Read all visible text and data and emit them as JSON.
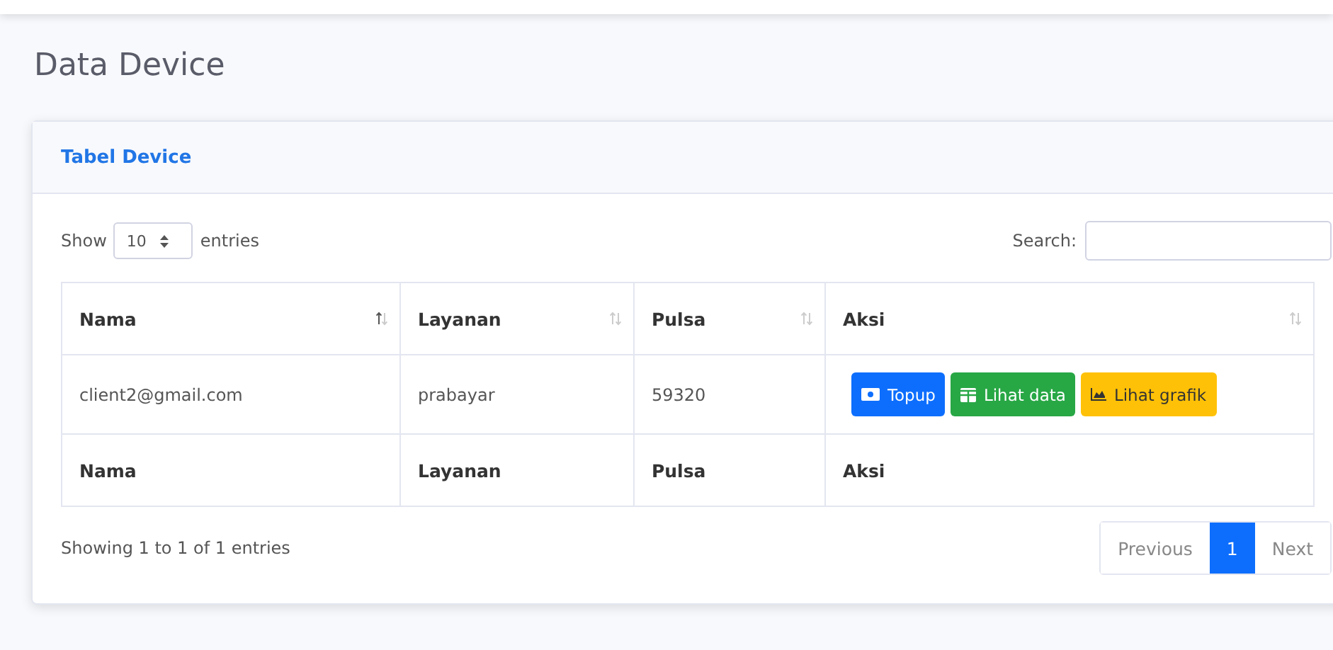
{
  "page_title": "Data Device",
  "card": {
    "title": "Tabel Device",
    "length_menu": {
      "label_before": "Show",
      "value": "10",
      "label_after": "entries"
    },
    "search": {
      "label": "Search:"
    },
    "table": {
      "columns": [
        {
          "label": "Nama",
          "sorted": true
        },
        {
          "label": "Layanan",
          "sorted": false
        },
        {
          "label": "Pulsa",
          "sorted": false
        },
        {
          "label": "Aksi",
          "sorted": false
        }
      ],
      "rows": [
        {
          "nama": "client2@gmail.com",
          "layanan": "prabayar",
          "pulsa": "59320",
          "actions": [
            {
              "label": "Topup",
              "kind": "primary"
            },
            {
              "label": "Lihat data",
              "kind": "success"
            },
            {
              "label": "Lihat grafik",
              "kind": "warning"
            }
          ]
        }
      ],
      "footer": [
        "Nama",
        "Layanan",
        "Pulsa",
        "Aksi"
      ]
    },
    "info": "Showing 1 to 1 of 1 entries",
    "pagination": [
      {
        "label": "Previous",
        "selected": false,
        "disabled": true
      },
      {
        "label": "1",
        "selected": true,
        "disabled": false
      },
      {
        "label": "Next",
        "selected": false,
        "disabled": true
      }
    ]
  }
}
